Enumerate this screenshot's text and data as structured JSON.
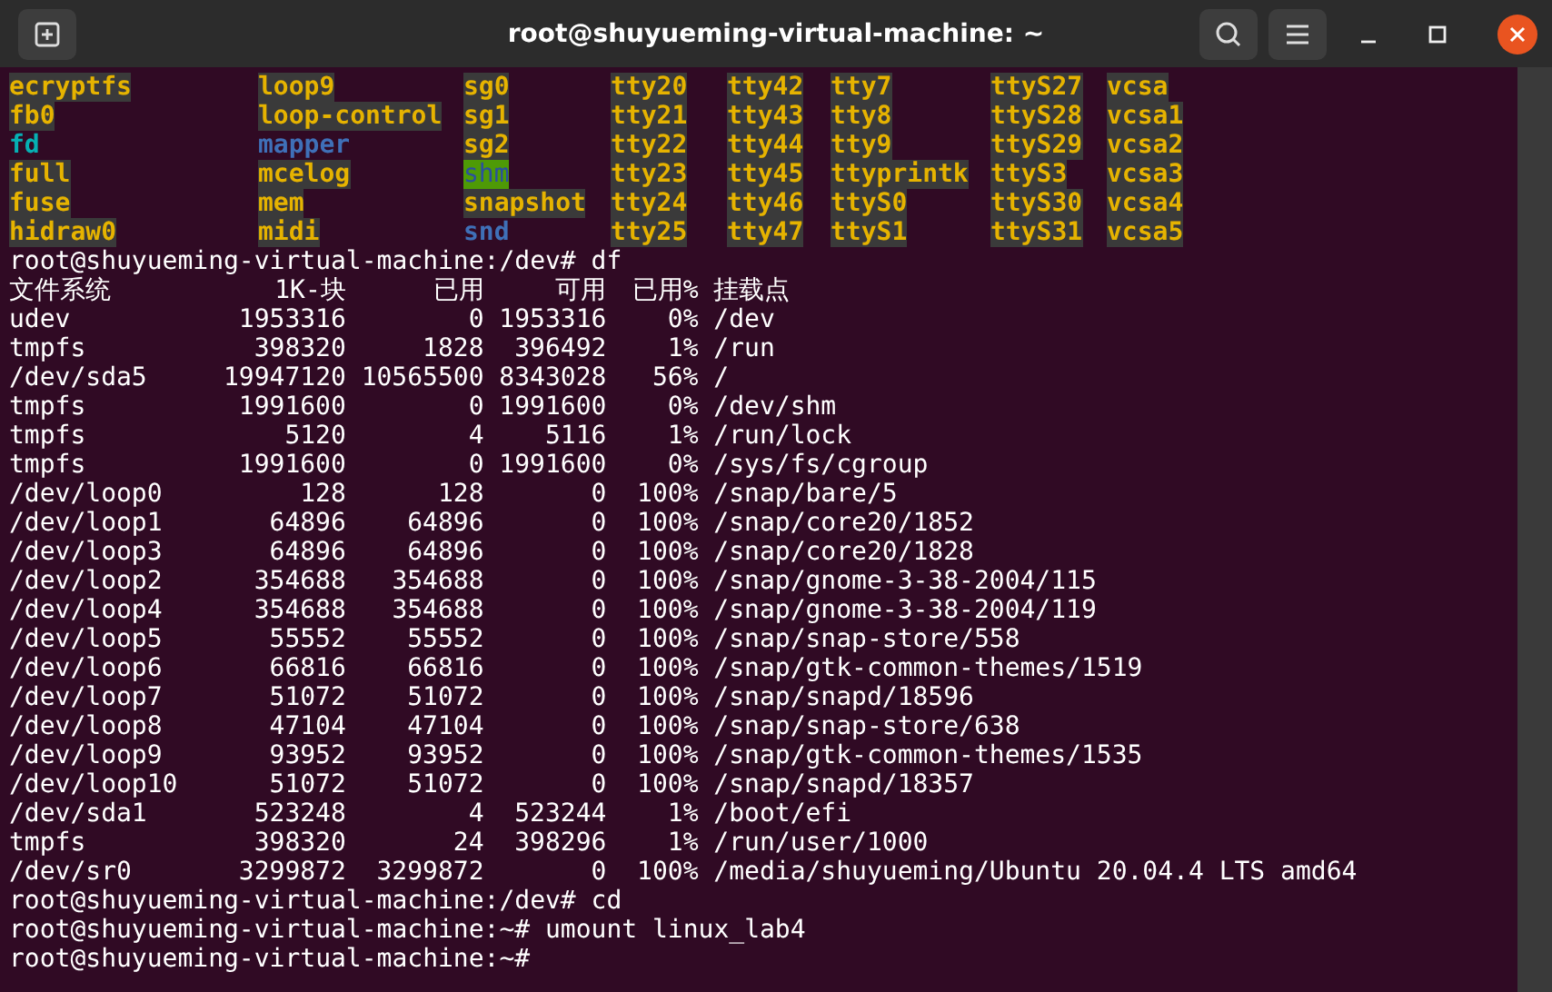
{
  "window": {
    "title": "root@shuyueming-virtual-machine: ~"
  },
  "terminal": {
    "blocks": [
      {
        "kind": "ls",
        "rows": [
          [
            {
              "name": "ecryptfs",
              "kind": "device"
            },
            {
              "name": "loop9",
              "kind": "device"
            },
            {
              "name": "sg0",
              "kind": "device"
            },
            {
              "name": "tty20",
              "kind": "device"
            },
            {
              "name": "tty42",
              "kind": "device"
            },
            {
              "name": "tty7",
              "kind": "device"
            },
            {
              "name": "ttyS27",
              "kind": "device"
            },
            {
              "name": "vcsa",
              "kind": "device"
            }
          ],
          [
            {
              "name": "fb0",
              "kind": "device"
            },
            {
              "name": "loop-control",
              "kind": "device"
            },
            {
              "name": "sg1",
              "kind": "device"
            },
            {
              "name": "tty21",
              "kind": "device"
            },
            {
              "name": "tty43",
              "kind": "device"
            },
            {
              "name": "tty8",
              "kind": "device"
            },
            {
              "name": "ttyS28",
              "kind": "device"
            },
            {
              "name": "vcsa1",
              "kind": "device"
            }
          ],
          [
            {
              "name": "fd",
              "kind": "symlink"
            },
            {
              "name": "mapper",
              "kind": "directory"
            },
            {
              "name": "sg2",
              "kind": "device"
            },
            {
              "name": "tty22",
              "kind": "device"
            },
            {
              "name": "tty44",
              "kind": "device"
            },
            {
              "name": "tty9",
              "kind": "device"
            },
            {
              "name": "ttyS29",
              "kind": "device"
            },
            {
              "name": "vcsa2",
              "kind": "device"
            }
          ],
          [
            {
              "name": "full",
              "kind": "device"
            },
            {
              "name": "mcelog",
              "kind": "device"
            },
            {
              "name": "shm",
              "kind": "sticky"
            },
            {
              "name": "tty23",
              "kind": "device"
            },
            {
              "name": "tty45",
              "kind": "device"
            },
            {
              "name": "ttyprintk",
              "kind": "device"
            },
            {
              "name": "ttyS3",
              "kind": "device"
            },
            {
              "name": "vcsa3",
              "kind": "device"
            }
          ],
          [
            {
              "name": "fuse",
              "kind": "device"
            },
            {
              "name": "mem",
              "kind": "device"
            },
            {
              "name": "snapshot",
              "kind": "device"
            },
            {
              "name": "tty24",
              "kind": "device"
            },
            {
              "name": "tty46",
              "kind": "device"
            },
            {
              "name": "ttyS0",
              "kind": "device"
            },
            {
              "name": "ttyS30",
              "kind": "device"
            },
            {
              "name": "vcsa4",
              "kind": "device"
            }
          ],
          [
            {
              "name": "hidraw0",
              "kind": "device"
            },
            {
              "name": "midi",
              "kind": "device"
            },
            {
              "name": "snd",
              "kind": "directory"
            },
            {
              "name": "tty25",
              "kind": "device"
            },
            {
              "name": "tty47",
              "kind": "device"
            },
            {
              "name": "ttyS1",
              "kind": "device"
            },
            {
              "name": "ttyS31",
              "kind": "device"
            },
            {
              "name": "vcsa5",
              "kind": "device"
            }
          ]
        ]
      },
      {
        "kind": "prompt",
        "prompt": "root@shuyueming-virtual-machine:/dev#",
        "command": "df"
      },
      {
        "kind": "df",
        "columns": [
          "文件系统",
          "1K-块",
          "已用",
          "可用",
          "已用%",
          "挂载点"
        ],
        "rows": [
          [
            "udev",
            "1953316",
            "0",
            "1953316",
            "0%",
            "/dev"
          ],
          [
            "tmpfs",
            "398320",
            "1828",
            "396492",
            "1%",
            "/run"
          ],
          [
            "/dev/sda5",
            "19947120",
            "10565500",
            "8343028",
            "56%",
            "/"
          ],
          [
            "tmpfs",
            "1991600",
            "0",
            "1991600",
            "0%",
            "/dev/shm"
          ],
          [
            "tmpfs",
            "5120",
            "4",
            "5116",
            "1%",
            "/run/lock"
          ],
          [
            "tmpfs",
            "1991600",
            "0",
            "1991600",
            "0%",
            "/sys/fs/cgroup"
          ],
          [
            "/dev/loop0",
            "128",
            "128",
            "0",
            "100%",
            "/snap/bare/5"
          ],
          [
            "/dev/loop1",
            "64896",
            "64896",
            "0",
            "100%",
            "/snap/core20/1852"
          ],
          [
            "/dev/loop3",
            "64896",
            "64896",
            "0",
            "100%",
            "/snap/core20/1828"
          ],
          [
            "/dev/loop2",
            "354688",
            "354688",
            "0",
            "100%",
            "/snap/gnome-3-38-2004/115"
          ],
          [
            "/dev/loop4",
            "354688",
            "354688",
            "0",
            "100%",
            "/snap/gnome-3-38-2004/119"
          ],
          [
            "/dev/loop5",
            "55552",
            "55552",
            "0",
            "100%",
            "/snap/snap-store/558"
          ],
          [
            "/dev/loop6",
            "66816",
            "66816",
            "0",
            "100%",
            "/snap/gtk-common-themes/1519"
          ],
          [
            "/dev/loop7",
            "51072",
            "51072",
            "0",
            "100%",
            "/snap/snapd/18596"
          ],
          [
            "/dev/loop8",
            "47104",
            "47104",
            "0",
            "100%",
            "/snap/snap-store/638"
          ],
          [
            "/dev/loop9",
            "93952",
            "93952",
            "0",
            "100%",
            "/snap/gtk-common-themes/1535"
          ],
          [
            "/dev/loop10",
            "51072",
            "51072",
            "0",
            "100%",
            "/snap/snapd/18357"
          ],
          [
            "/dev/sda1",
            "523248",
            "4",
            "523244",
            "1%",
            "/boot/efi"
          ],
          [
            "tmpfs",
            "398320",
            "24",
            "398296",
            "1%",
            "/run/user/1000"
          ],
          [
            "/dev/sr0",
            "3299872",
            "3299872",
            "0",
            "100%",
            "/media/shuyueming/Ubuntu 20.04.4 LTS amd64"
          ]
        ]
      },
      {
        "kind": "prompt",
        "prompt": "root@shuyueming-virtual-machine:/dev#",
        "command": "cd"
      },
      {
        "kind": "prompt",
        "prompt": "root@shuyueming-virtual-machine:~#",
        "command": "umount linux_lab4"
      },
      {
        "kind": "prompt",
        "prompt": "root@shuyueming-virtual-machine:~#"
      }
    ]
  }
}
